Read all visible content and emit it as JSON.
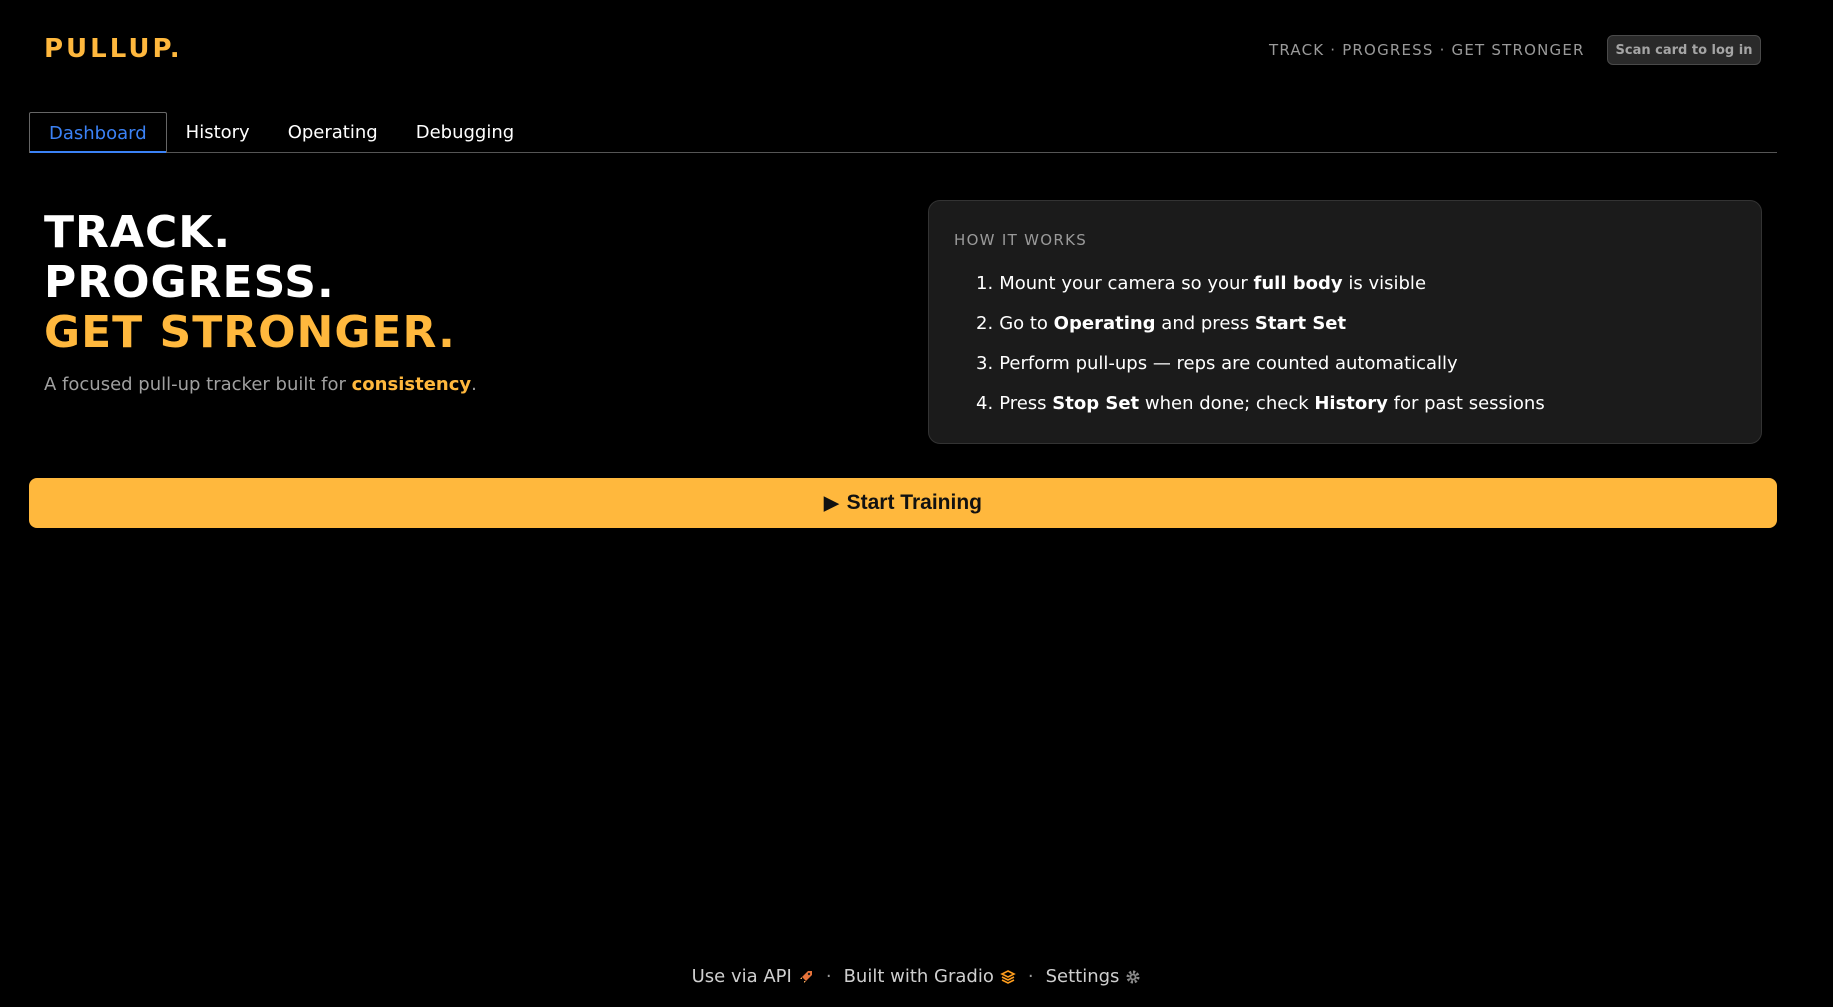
{
  "header": {
    "logo": "PULLUP.",
    "tagline": "TRACK · PROGRESS · GET STRONGER",
    "login_button": "Scan card to log in"
  },
  "tabs": [
    {
      "label": "Dashboard",
      "active": true
    },
    {
      "label": "History",
      "active": false
    },
    {
      "label": "Operating",
      "active": false
    },
    {
      "label": "Debugging",
      "active": false
    }
  ],
  "hero": {
    "line1": "TRACK.",
    "line2": "PROGRESS.",
    "line3": "GET STRONGER.",
    "subtitle_prefix": "A focused pull-up tracker built for ",
    "subtitle_highlight": "consistency",
    "subtitle_suffix": "."
  },
  "how_it_works": {
    "title": "HOW IT WORKS",
    "steps": [
      {
        "num": "1.",
        "parts": [
          {
            "t": "Mount your camera so your "
          },
          {
            "t": "full body",
            "b": true
          },
          {
            "t": " is visible"
          }
        ]
      },
      {
        "num": "2.",
        "parts": [
          {
            "t": "Go to "
          },
          {
            "t": "Operating",
            "b": true
          },
          {
            "t": " and press "
          },
          {
            "t": "Start Set",
            "b": true
          }
        ]
      },
      {
        "num": "3.",
        "parts": [
          {
            "t": "Perform pull-ups — reps are counted automatically"
          }
        ]
      },
      {
        "num": "4.",
        "parts": [
          {
            "t": "Press "
          },
          {
            "t": "Stop Set",
            "b": true
          },
          {
            "t": " when done; check "
          },
          {
            "t": "History",
            "b": true
          },
          {
            "t": " for past sessions"
          }
        ]
      }
    ]
  },
  "start_button": {
    "icon": "play-icon",
    "label": "Start Training"
  },
  "footer": {
    "api_label": "Use via API",
    "api_icon": "rocket-icon",
    "separator": "·",
    "gradio_label": "Built with Gradio",
    "gradio_icon": "gradio-logo-icon",
    "settings_label": "Settings",
    "settings_icon": "gear-icon"
  },
  "colors": {
    "accent": "#ffb83d",
    "active_tab": "#3b82f6",
    "background": "#000000",
    "card": "#1b1b1b"
  }
}
